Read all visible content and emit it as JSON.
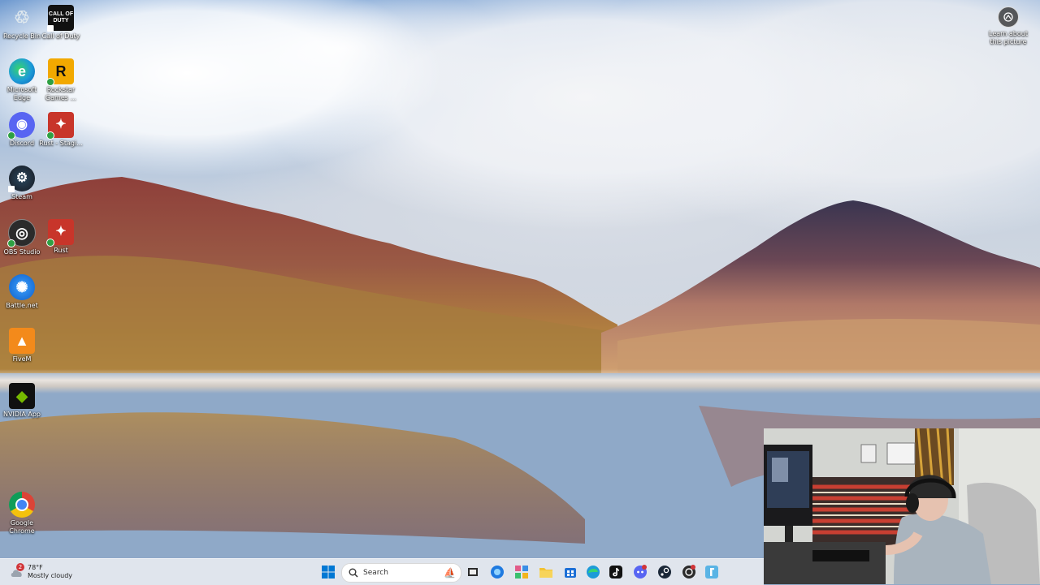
{
  "desktop": {
    "icons": [
      {
        "label": "Recycle Bin",
        "glyph": "♲",
        "icon": "recycle-bin-icon"
      },
      {
        "label": "Call of Duty",
        "glyph": "CALL OF DUTY",
        "icon": "call-of-duty-icon"
      },
      {
        "label": "Microsoft Edge",
        "glyph": "e",
        "icon": "edge-icon"
      },
      {
        "label": "Rockstar Games ...",
        "glyph": "R",
        "icon": "rockstar-icon"
      },
      {
        "label": "Discord",
        "glyph": "◉",
        "icon": "discord-icon"
      },
      {
        "label": "Rust - Stagi...",
        "glyph": "✦",
        "icon": "rust-staging-icon"
      },
      {
        "label": "Steam",
        "glyph": "⚙",
        "icon": "steam-icon"
      },
      {
        "label": "OBS Studio",
        "glyph": "◎",
        "icon": "obs-icon"
      },
      {
        "label": "Rust",
        "glyph": "✦",
        "icon": "rust-icon"
      },
      {
        "label": "Battle.net",
        "glyph": "✺",
        "icon": "battlenet-icon"
      },
      {
        "label": "FiveM",
        "glyph": "▲",
        "icon": "fivem-icon"
      },
      {
        "label": "NVIDIA App",
        "glyph": "◆",
        "icon": "nvidia-icon"
      },
      {
        "label": "Google Chrome",
        "glyph": "●",
        "icon": "chrome-icon"
      }
    ]
  },
  "spotlight": {
    "label": "Learn about this picture"
  },
  "taskbar": {
    "weather": {
      "temp": "78°F",
      "condition": "Mostly cloudy",
      "badge": "2"
    },
    "search": {
      "placeholder": "Search"
    }
  },
  "colors": {
    "taskbar_bg": "#e6e9f0",
    "start_blue": "#0078d4"
  }
}
